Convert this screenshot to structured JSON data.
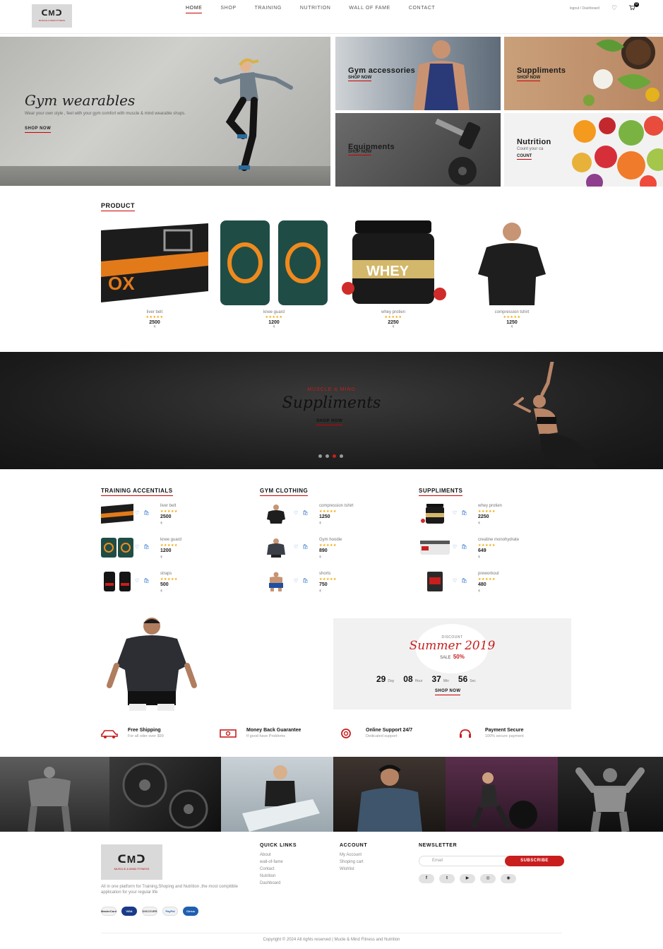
{
  "header": {
    "logo_mark": "ᑕMᑐ",
    "logo_text": "MUSCLE & MIND FITNESS",
    "nav": [
      {
        "label": "HOME"
      },
      {
        "label": "SHOP"
      },
      {
        "label": "TRAINING"
      },
      {
        "label": "NUTRITION"
      },
      {
        "label": "WALL OF FAME"
      },
      {
        "label": "CONTACT"
      }
    ],
    "account_links": "logout / Dashboard",
    "cart_count": "0"
  },
  "hero": {
    "title": "Gym wearables",
    "description": "Wear your own style , feel with your gym comfort with muscle & mind wearable shops.",
    "cta": "SHOP NOW"
  },
  "tiles": [
    {
      "title": "Gym accessories",
      "cta": "SHOP NOW"
    },
    {
      "title": "Suppliments",
      "cta": "SHOP NOW"
    },
    {
      "title": "Equipments",
      "cta": "SHOP NOW"
    },
    {
      "title": "Nutrition",
      "subtitle": "Count your ca",
      "cta": "COUNT"
    }
  ],
  "products": {
    "title": "PRODUCT",
    "items": [
      {
        "name": "liver belt",
        "stars": "★★★★★",
        "price": "2500",
        "currency": "₹"
      },
      {
        "name": "knee guard",
        "stars": "★★★★★",
        "price": "1200",
        "currency": "₹"
      },
      {
        "name": "whey protien",
        "stars": "★★★★★",
        "price": "2250",
        "currency": "₹"
      },
      {
        "name": "compression tshirt",
        "stars": "★★★★★",
        "price": "1250",
        "currency": "₹"
      }
    ]
  },
  "banner": {
    "eyebrow": "MUSCLE & MIND",
    "title": "Suppliments",
    "cta": "SHOP NOW",
    "active_slide": 3,
    "slide_count": 4
  },
  "categories": [
    {
      "title": "TRAINING ACCENTIALS",
      "items": [
        {
          "name": "liver belt",
          "stars": "★★★★★",
          "price": "2500",
          "currency": "₹"
        },
        {
          "name": "knee guard",
          "stars": "★★★★★",
          "price": "1200",
          "currency": "₹"
        },
        {
          "name": "straps",
          "stars": "★★★★★",
          "price": "500",
          "currency": "₹"
        }
      ]
    },
    {
      "title": "GYM CLOTHING",
      "items": [
        {
          "name": "compression tshirt",
          "stars": "★★★★★",
          "price": "1250",
          "currency": "₹"
        },
        {
          "name": "Gym hoodie",
          "stars": "★★★★★",
          "price": "890",
          "currency": "₹"
        },
        {
          "name": "shorts",
          "stars": "★★★★★",
          "price": "750",
          "currency": "₹"
        }
      ]
    },
    {
      "title": "SUPPLIMENTS",
      "items": [
        {
          "name": "whey protien",
          "stars": "★★★★★",
          "price": "2250",
          "currency": "₹"
        },
        {
          "name": "creatine monohydrate",
          "stars": "★★★★★",
          "price": "649",
          "currency": "₹"
        },
        {
          "name": "preworkout",
          "stars": "★★★★★",
          "price": "480",
          "currency": "₹"
        }
      ]
    }
  ],
  "item_actions": "♡ 🛍",
  "deal": {
    "label": "DISCOUNT",
    "title": "Summer 2019",
    "sale_label": "SALE",
    "sale_value": "50%",
    "countdown": [
      {
        "value": "29",
        "unit": "Day"
      },
      {
        "value": "08",
        "unit": "Hour"
      },
      {
        "value": "37",
        "unit": "Min"
      },
      {
        "value": "56",
        "unit": "Sec"
      }
    ],
    "cta": "SHOP NOW"
  },
  "features": [
    {
      "title": "Free Shipping",
      "subtitle": "For all oder over $99"
    },
    {
      "title": "Money Back Guarantee",
      "subtitle": "If good have Problems"
    },
    {
      "title": "Online Support 24/7",
      "subtitle": "Dedicated support"
    },
    {
      "title": "Payment Secure",
      "subtitle": "100% secure payment"
    }
  ],
  "footer": {
    "logo_mark": "ᑕMᑐ",
    "logo_text": "MUSCLE & MIND FITNESS",
    "description": "All in one platform for Training,Shoping and Nutrition ,the most compitible application for your regular life",
    "payments": [
      "MasterCard",
      "VISA",
      "DISCOVER",
      "PayPal",
      "Cirrus"
    ],
    "quick_links_title": "QUICK LINKS",
    "quick_links": [
      "About",
      "wall-of-fame",
      "Contact",
      "Nutrition",
      "Dashboard"
    ],
    "account_title": "ACCOUNT",
    "account_links": [
      "My Account",
      "Shoping cart",
      "Wishlist"
    ],
    "newsletter_title": "NEWSLETTER",
    "email_placeholder": "Email",
    "subscribe": "SUBSCRIBE",
    "social": [
      "f",
      "t",
      "▶",
      "◎",
      "◉"
    ],
    "copyright": "Copyright © 2024 All rights reserved | Mucle & Mind Fitness and Nutrition"
  },
  "colors": {
    "accent": "#c81e1e",
    "star": "#f0a500",
    "action": "#3b7cd1"
  }
}
